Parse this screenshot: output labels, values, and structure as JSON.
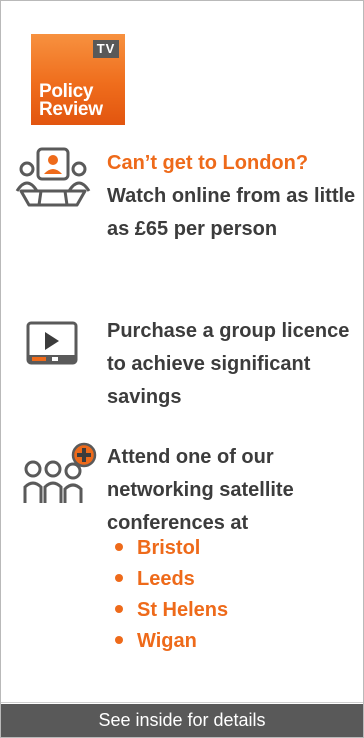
{
  "logo": {
    "badge": "TV",
    "line1": "Policy",
    "line2": "Review"
  },
  "features": [
    {
      "icon": "video-conference-icon",
      "highlight": "Can’t get to London?",
      "text": "Watch online from as little as £65 per person"
    },
    {
      "icon": "video-player-icon",
      "text": "Purchase a group licence to achieve significant savings"
    },
    {
      "icon": "group-add-icon",
      "text": "Attend one of our networking satellite conferences at"
    }
  ],
  "locations": [
    "Bristol",
    "Leeds",
    "St Helens",
    "Wigan"
  ],
  "footer": {
    "label": "See inside for details"
  },
  "colors": {
    "accent": "#ee6a1a",
    "text": "#3c3c3c",
    "footer_bg": "#595959",
    "icon_grey": "#5a5a5a"
  }
}
